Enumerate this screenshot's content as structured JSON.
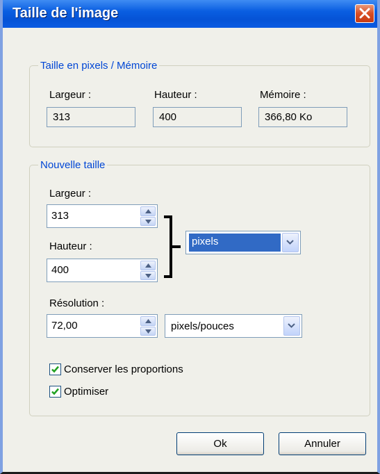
{
  "dialog": {
    "title": "Taille de l'image"
  },
  "pixels_group": {
    "legend": "Taille en pixels / Mémoire",
    "width_label": "Largeur :",
    "width_value": "313",
    "height_label": "Hauteur :",
    "height_value": "400",
    "memory_label": "Mémoire :",
    "memory_value": "366,80 Ko"
  },
  "new_size_group": {
    "legend": "Nouvelle taille",
    "width_label": "Largeur :",
    "width_value": "313",
    "height_label": "Hauteur :",
    "height_value": "400",
    "unit_value": "pixels",
    "resolution_label": "Résolution :",
    "resolution_value": "72,00",
    "resolution_unit": "pixels/pouces"
  },
  "options": {
    "keep_proportions": {
      "label": "Conserver les proportions",
      "checked": true
    },
    "optimize": {
      "label": "Optimiser",
      "checked": true
    }
  },
  "buttons": {
    "ok": "Ok",
    "cancel": "Annuler"
  }
}
